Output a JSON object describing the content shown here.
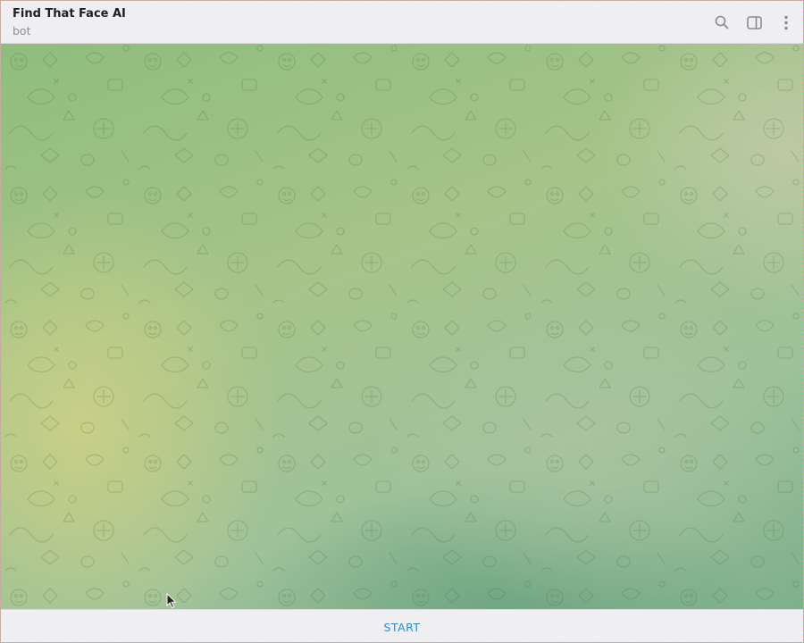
{
  "header": {
    "title": "Find That Face AI",
    "subtitle": "bot",
    "icons": [
      "search-icon",
      "sidebar-toggle-icon",
      "more-options-icon"
    ]
  },
  "bottom_bar": {
    "start_label": "START"
  },
  "colors": {
    "header_bg": "#efeef1",
    "accent": "#2f8ec7",
    "title_text": "#1f1f1f",
    "subtitle_text": "#8e8e93",
    "wallpaper_green": "#9cc08a"
  }
}
